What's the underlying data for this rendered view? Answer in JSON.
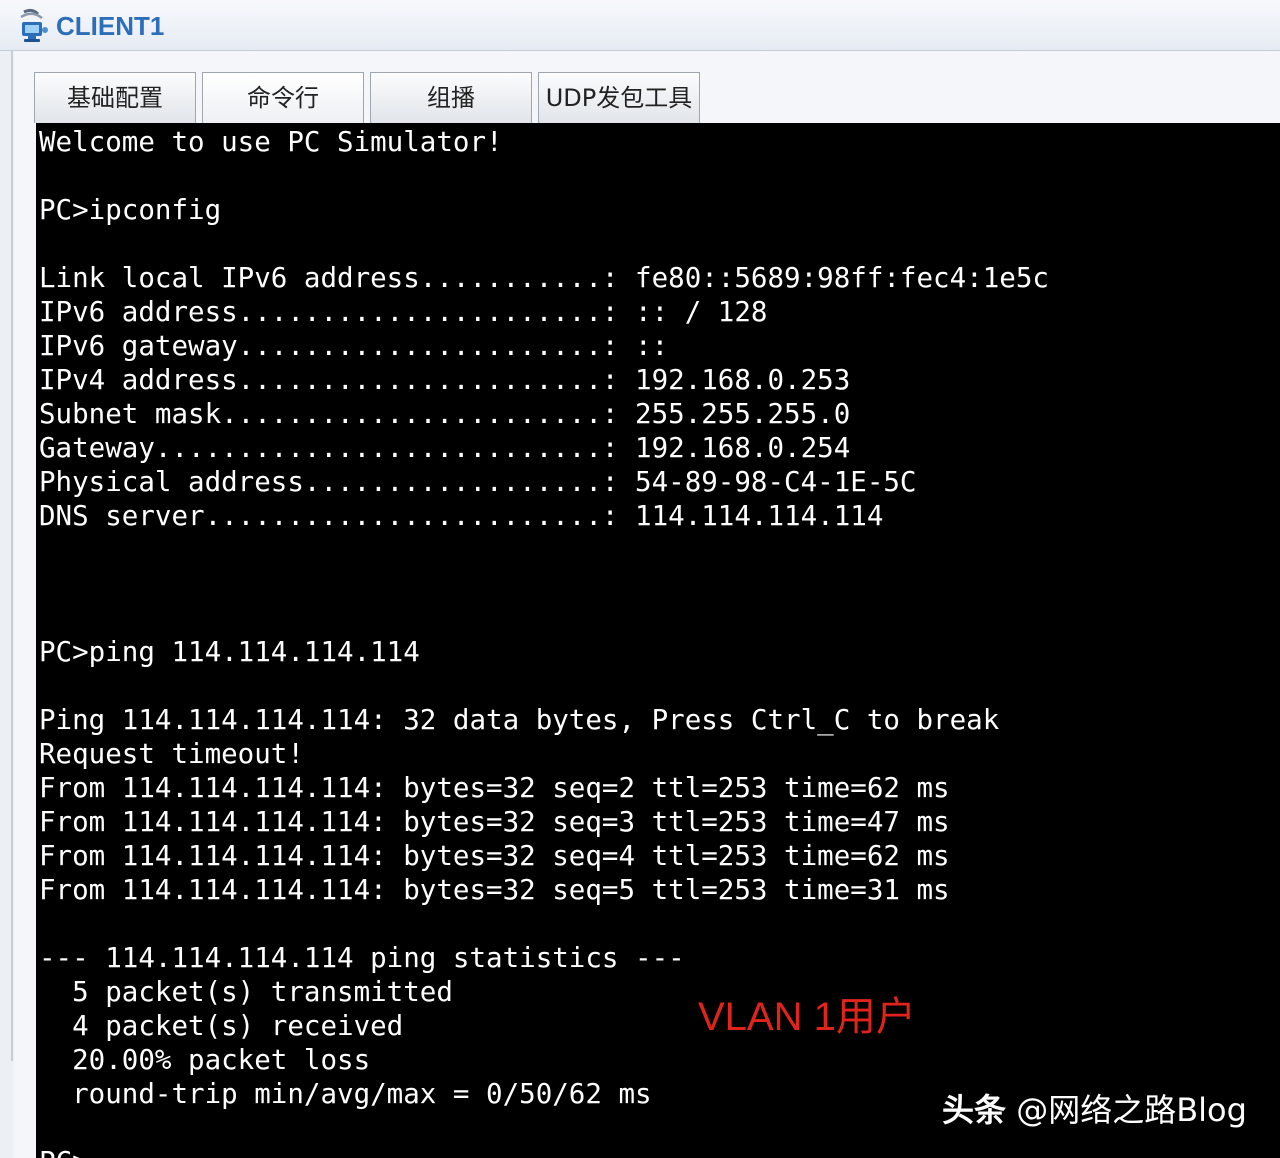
{
  "window": {
    "title": "CLIENT1",
    "accent_color": "#2c6fb8",
    "icon": "network-client-icon"
  },
  "tabs": [
    {
      "label": "基础配置",
      "active": false
    },
    {
      "label": "命令行",
      "active": true
    },
    {
      "label": "组播",
      "active": false
    },
    {
      "label": "UDP发包工具",
      "active": false
    }
  ],
  "terminal": {
    "background": "#000000",
    "foreground": "#ffffff",
    "lines": [
      "Welcome to use PC Simulator!",
      "",
      "PC>ipconfig",
      "",
      "Link local IPv6 address...........: fe80::5689:98ff:fec4:1e5c",
      "IPv6 address......................: :: / 128",
      "IPv6 gateway......................: ::",
      "IPv4 address......................: 192.168.0.253",
      "Subnet mask.......................: 255.255.255.0",
      "Gateway...........................: 192.168.0.254",
      "Physical address..................: 54-89-98-C4-1E-5C",
      "DNS server........................: 114.114.114.114",
      "",
      "",
      "",
      "PC>ping 114.114.114.114",
      "",
      "Ping 114.114.114.114: 32 data bytes, Press Ctrl_C to break",
      "Request timeout!",
      "From 114.114.114.114: bytes=32 seq=2 ttl=253 time=62 ms",
      "From 114.114.114.114: bytes=32 seq=3 ttl=253 time=47 ms",
      "From 114.114.114.114: bytes=32 seq=4 ttl=253 time=62 ms",
      "From 114.114.114.114: bytes=32 seq=5 ttl=253 time=31 ms",
      "",
      "--- 114.114.114.114 ping statistics ---",
      "  5 packet(s) transmitted",
      "  4 packet(s) received",
      "  20.00% packet loss",
      "  round-trip min/avg/max = 0/50/62 ms",
      "",
      "PC>"
    ]
  },
  "annotation": {
    "text": "VLAN 1用户",
    "color": "#e0241b"
  },
  "watermark": {
    "prefix": "头条",
    "handle": " @网络之路Blog"
  }
}
